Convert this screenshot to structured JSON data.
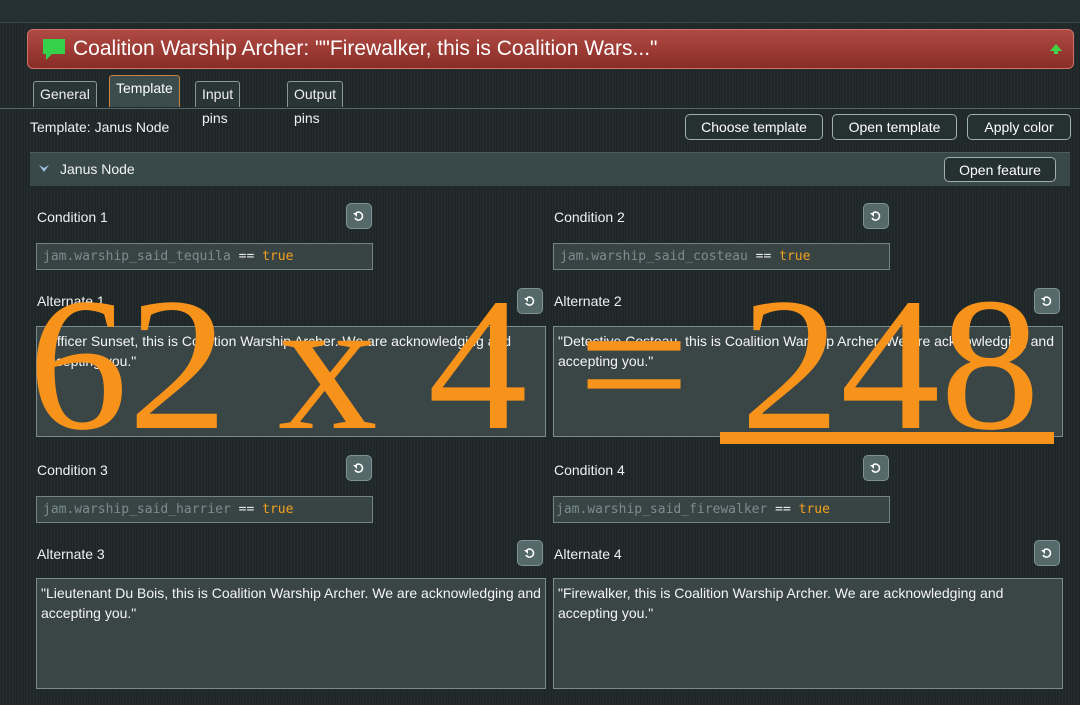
{
  "title": "Coalition Warship Archer: \"\"Firewalker, this is Coalition Wars...\"",
  "tabs": [
    {
      "label": "General"
    },
    {
      "label": "Template"
    },
    {
      "label": "Input pins"
    },
    {
      "label": "Output pins"
    }
  ],
  "template_row": {
    "label": "Template: Janus Node",
    "choose_template": "Choose template",
    "open_template": "Open template",
    "apply_color": "Apply color"
  },
  "feature": {
    "label": "Janus Node",
    "open_feature": "Open feature"
  },
  "fields": {
    "condition1": {
      "label": "Condition 1",
      "var": "jam.warship_said_tequila",
      "op": "==",
      "val": "true"
    },
    "condition2": {
      "label": "Condition 2",
      "var": "jam.warship_said_costeau",
      "op": "==",
      "val": "true"
    },
    "condition3": {
      "label": "Condition 3",
      "var": "jam.warship_said_harrier",
      "op": "==",
      "val": "true"
    },
    "condition4": {
      "label": "Condition 4",
      "var": "jam.warship_said_firewalker",
      "op": "==",
      "val": "true"
    },
    "alternate1": {
      "label": "Alternate 1",
      "text": "\"Officer Sunset, this is Coalition Warship Archer. We are acknowledging and accepting you.\""
    },
    "alternate2": {
      "label": "Alternate 2",
      "text": "\"Detective Costeau, this is Coalition Warship Archer. We are acknowledging and accepting you.\""
    },
    "alternate3": {
      "label": "Alternate 3",
      "text": "\"Lieutenant Du Bois, this is Coalition Warship Archer. We are acknowledging and accepting you.\""
    },
    "alternate4": {
      "label": "Alternate 4",
      "text": "\"Firewalker, this is Coalition Warship Archer. We are acknowledging and accepting you.\""
    }
  },
  "overlay": {
    "equation": "62 x 4 = 248",
    "color": "#f7931a"
  },
  "icons": {
    "title": "speech-bubble-icon",
    "collapse": "collapse-arrow-icon",
    "chevron": "chevron-down-icon",
    "reset": "undo-icon"
  },
  "colors": {
    "title_bar": "#9e3c35",
    "active_tab_border": "#c8843a",
    "keyword": "#f2a11e",
    "background": "#1f2728"
  }
}
